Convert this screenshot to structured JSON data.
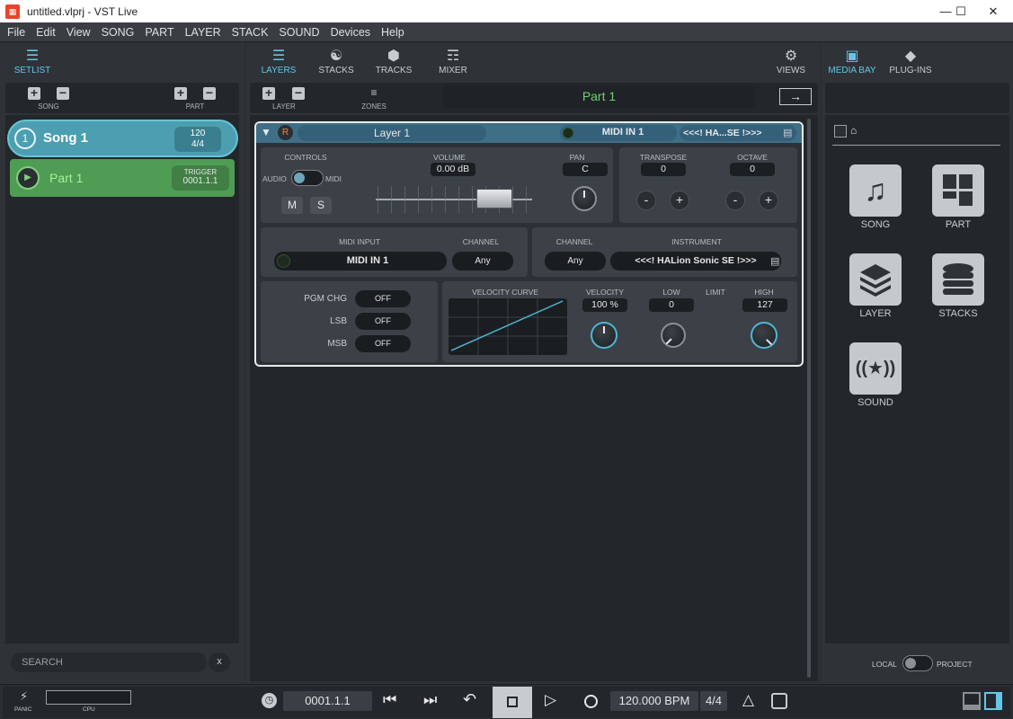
{
  "window": {
    "title": "untitled.vlprj - VST Live",
    "controls": [
      "—",
      "☐",
      "✕"
    ]
  },
  "menu": [
    "File",
    "Edit",
    "View",
    "SONG",
    "PART",
    "LAYER",
    "STACK",
    "SOUND",
    "Devices",
    "Help"
  ],
  "left": {
    "setlist_label": "SETLIST",
    "song_label": "SONG",
    "part_label": "PART",
    "song": {
      "number": "1",
      "name": "Song 1",
      "tempo": "120",
      "signature": "4/4"
    },
    "part": {
      "name": "Part 1",
      "trigger_label": "TRIGGER",
      "trigger_value": "0001.1.1"
    },
    "search_placeholder": "SEARCH",
    "search_clear": "x"
  },
  "center": {
    "tabs": [
      {
        "label": "LAYERS",
        "icon": "layers-icon"
      },
      {
        "label": "STACKS",
        "icon": "stacks-icon"
      },
      {
        "label": "TRACKS",
        "icon": "tracks-icon"
      },
      {
        "label": "MIXER",
        "icon": "mixer-icon"
      }
    ],
    "views_label": "VIEWS",
    "layer_label": "LAYER",
    "zones_label": "ZONES",
    "part_title": "Part 1",
    "layer": {
      "record_label": "R",
      "name": "Layer 1",
      "midi_in": "MIDI IN 1",
      "instrument_short": "<<<! HA...SE !>>>",
      "controls_label": "CONTROLS",
      "audio_label": "AUDIO",
      "midi_label": "MIDI",
      "mute_label": "M",
      "solo_label": "S",
      "volume_label": "VOLUME",
      "volume_value": "0.00 dB",
      "pan_label": "PAN",
      "pan_value": "C",
      "transpose_label": "TRANSPOSE",
      "transpose_value": "0",
      "octave_label": "OCTAVE",
      "octave_value": "0",
      "minus": "-",
      "plus": "+",
      "midi_input_label": "MIDI INPUT",
      "midi_input_value": "MIDI IN 1",
      "channel_label": "CHANNEL",
      "channel_in_value": "Any",
      "channel_out_value": "Any",
      "instrument_label": "INSTRUMENT",
      "instrument_value": "<<<! HALion Sonic SE !>>>",
      "pgm_chg_label": "PGM CHG",
      "lsb_label": "LSB",
      "msb_label": "MSB",
      "off": "OFF",
      "velocity_curve_label": "VELOCITY CURVE",
      "velocity_label": "VELOCITY",
      "velocity_value": "100 %",
      "low_label": "LOW",
      "low_value": "0",
      "limit_label": "LIMIT",
      "high_label": "HIGH",
      "high_value": "127"
    }
  },
  "right": {
    "tabs": [
      {
        "label": "MEDIA BAY",
        "icon": "media-bay-icon"
      },
      {
        "label": "PLUG-INS",
        "icon": "plugins-icon"
      }
    ],
    "tiles": [
      {
        "label": "SONG",
        "icon": "music-note-icon"
      },
      {
        "label": "PART",
        "icon": "part-grid-icon"
      },
      {
        "label": "LAYER",
        "icon": "layer-stack-icon"
      },
      {
        "label": "STACKS",
        "icon": "database-stack-icon"
      },
      {
        "label": "SOUND",
        "icon": "sound-broadcast-icon"
      }
    ],
    "local_label": "LOCAL",
    "project_label": "PROJECT"
  },
  "transport": {
    "panic_label": "PANIC",
    "cpu_label": "CPU",
    "position": "0001.1.1",
    "tempo": "120.000 BPM",
    "signature": "4/4"
  }
}
